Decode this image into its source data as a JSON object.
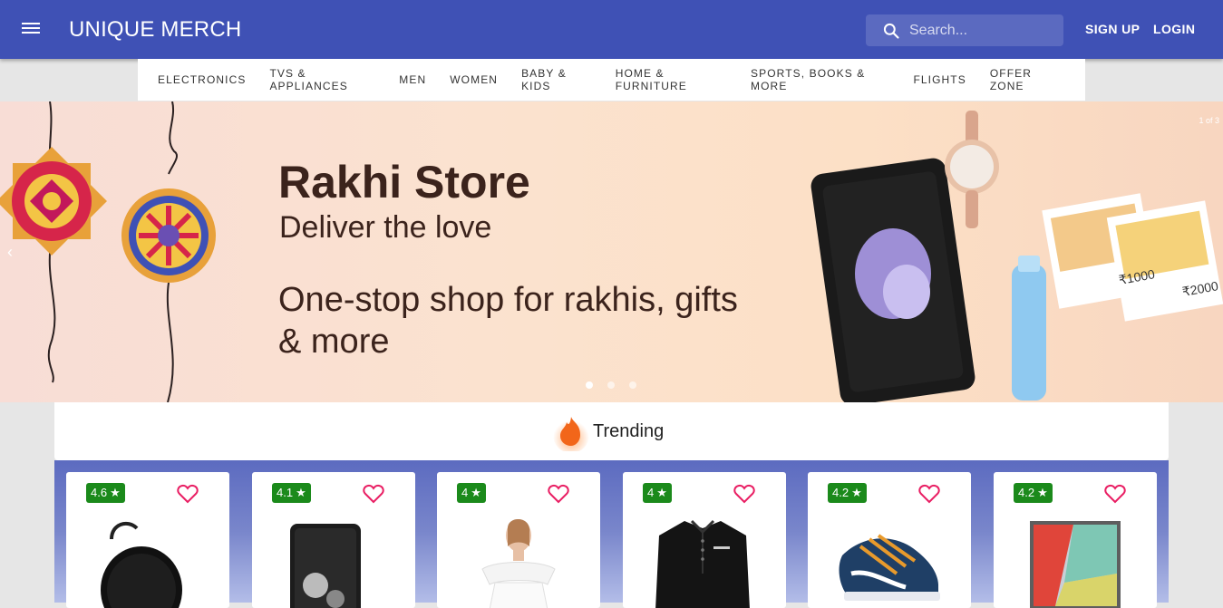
{
  "header": {
    "brand": "UNIQUE MERCH",
    "search_placeholder": "Search...",
    "signup_label": "SIGN UP",
    "login_label": "LOGIN"
  },
  "categories": [
    "ELECTRONICS",
    "TVS & APPLIANCES",
    "MEN",
    "WOMEN",
    "BABY & KIDS",
    "HOME & FURNITURE",
    "SPORTS, BOOKS & MORE",
    "FLIGHTS",
    "OFFER ZONE"
  ],
  "hero": {
    "title": "Rakhi Store",
    "subtitle": "Deliver the love",
    "tagline": "One-stop shop for rakhis, gifts & more",
    "counter": "1 of 3",
    "gift_card_1": "₹1000",
    "gift_card_2": "₹2000"
  },
  "trending": {
    "title": "Trending",
    "products": [
      {
        "rating": "4.6",
        "icon": "speaker"
      },
      {
        "rating": "4.1",
        "icon": "phone"
      },
      {
        "rating": "4",
        "icon": "dress"
      },
      {
        "rating": "4",
        "icon": "shirt"
      },
      {
        "rating": "4.2",
        "icon": "shoes"
      },
      {
        "rating": "4.2",
        "icon": "laptop"
      }
    ]
  },
  "colors": {
    "primary": "#3f51b5",
    "rating_green": "#1b8a1b",
    "heart_pink": "#e91e63",
    "hero_text": "#3b231c"
  }
}
